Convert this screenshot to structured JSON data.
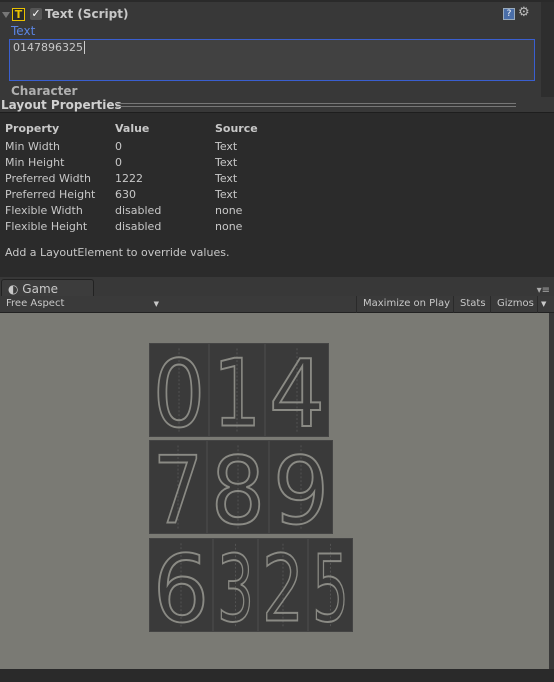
{
  "inspector": {
    "component_title": "Text (Script)",
    "enabled": true,
    "text_label": "Text",
    "text_value": "0147896325",
    "section_label": "Character"
  },
  "layout_properties": {
    "title": "Layout Properties",
    "headers": [
      "Property",
      "Value",
      "Source"
    ],
    "rows": [
      [
        "Min Width",
        "0",
        "Text"
      ],
      [
        "Min Height",
        "0",
        "Text"
      ],
      [
        "Preferred Width",
        "1222",
        "Text"
      ],
      [
        "Preferred Height",
        "630",
        "Text"
      ],
      [
        "Flexible Width",
        "disabled",
        "none"
      ],
      [
        "Flexible Height",
        "disabled",
        "none"
      ]
    ],
    "note": "Add a LayoutElement to override values."
  },
  "game": {
    "tab_label": "Game",
    "aspect": "Free Aspect",
    "maximize": "Maximize on Play",
    "stats": "Stats",
    "gizmos": "Gizmos",
    "rows": [
      [
        "0",
        "1",
        "4"
      ],
      [
        "7",
        "8",
        "9"
      ],
      [
        "6",
        "3",
        "2",
        "5"
      ]
    ]
  },
  "colors": {
    "accent": "#3a5fd0",
    "label_blue": "#5b84e0",
    "viewport": "#7a7a74",
    "tile": "#3a3a3a",
    "glyph": "#8a8a84"
  }
}
